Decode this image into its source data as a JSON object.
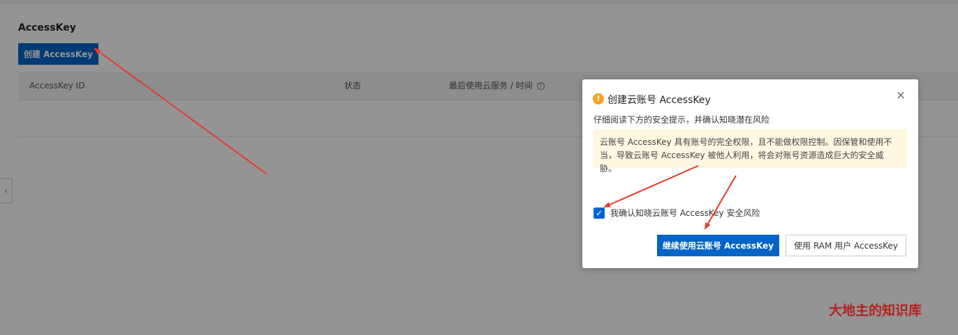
{
  "section": {
    "title": "AccessKey"
  },
  "toolbar": {
    "create_label": "创建 AccessKey"
  },
  "table": {
    "columns": [
      "AccessKey ID",
      "状态",
      "最后使用云服务 / 时间"
    ],
    "help_icon": "?"
  },
  "dialog": {
    "icon": "!",
    "title": "创建云账号 AccessKey",
    "subtitle": "仔细阅读下方的安全提示，并确认知晓潜在风险",
    "alert_line1": "云账号 AccessKey 具有账号的完全权限，且不能做权限控制。因保管和使用不",
    "alert_line2": "当，导致云账号 AccessKey 被他人利用，将会对账号资源造成巨大的安全威胁。",
    "checkbox_label": "我确认知晓云账号 AccessKey 安全风险",
    "checkbox_checked": true,
    "continue_label": "继续使用云账号 AccessKey",
    "ram_label": "使用 RAM 用户 AccessKey",
    "close_glyph": "×"
  },
  "collapse_glyph": "‹",
  "watermark": "大地主的知识库",
  "colors": {
    "primary": "#0064c8",
    "warning": "#f5a623",
    "arrow": "#e8392c",
    "alert_bg": "#fff7e0"
  }
}
